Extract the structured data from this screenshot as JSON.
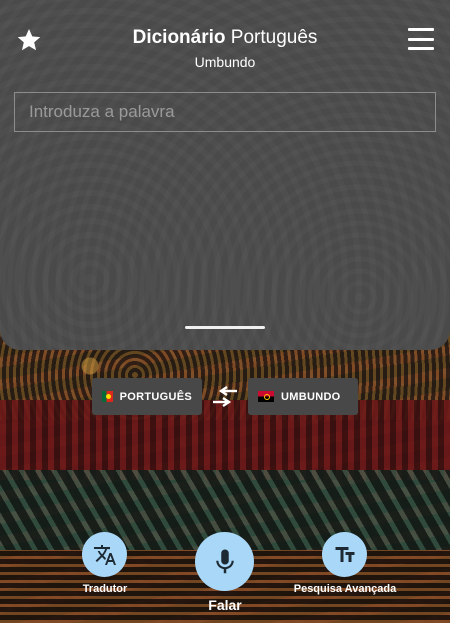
{
  "header": {
    "title_bold": "Dicionário",
    "title_rest": " Português",
    "subtitle": "Umbundo"
  },
  "search": {
    "placeholder": "Introduza a palavra",
    "value": ""
  },
  "languages": {
    "source": "PORTUGUÊS",
    "target": "UMBUNDO"
  },
  "actions": {
    "translator_label": "Tradutor",
    "speak_label": "Falar",
    "advanced_label": "Pesquisa Avançada"
  },
  "icons": {
    "favorite": "star-icon",
    "menu": "hamburger-menu-icon",
    "swap": "swap-arrows-icon",
    "translator": "translate-icon",
    "speak": "microphone-icon",
    "advanced": "text-size-icon"
  },
  "colors": {
    "panel": "#4a4a4a",
    "accent_button": "#a9d7f7",
    "lang_chip": "#484848"
  }
}
